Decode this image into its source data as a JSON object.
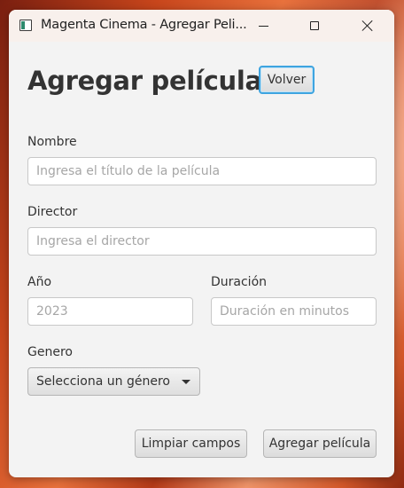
{
  "window": {
    "title": "Magenta Cinema - Agregar Peli...",
    "icon": "app-window-icon"
  },
  "header": {
    "title": "Agregar película",
    "back_label": "Volver"
  },
  "form": {
    "nombre": {
      "label": "Nombre",
      "placeholder": "Ingresa el título de la película",
      "value": ""
    },
    "director": {
      "label": "Director",
      "placeholder": "Ingresa el director",
      "value": ""
    },
    "anio": {
      "label": "Año",
      "placeholder": "2023",
      "value": ""
    },
    "duracion": {
      "label": "Duración",
      "placeholder": "Duración en minutos",
      "value": ""
    },
    "genero": {
      "label": "Genero",
      "selected": "Selecciona un género"
    }
  },
  "actions": {
    "clear_label": "Limpiar campos",
    "add_label": "Agregar película"
  },
  "colors": {
    "focus_accent": "#3ea4e0",
    "window_bg": "#f3f3f3"
  }
}
